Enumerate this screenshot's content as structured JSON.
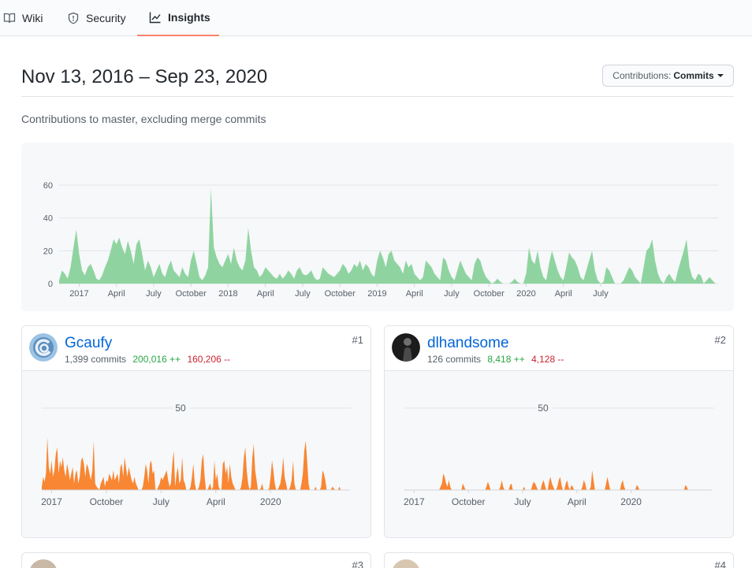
{
  "tabs": [
    {
      "label": "Wiki",
      "icon": "book-icon"
    },
    {
      "label": "Security",
      "icon": "shield-icon"
    },
    {
      "label": "Insights",
      "icon": "graph-icon",
      "active": true
    }
  ],
  "header": {
    "range": "Nov 13, 2016 – Sep 23, 2020",
    "contrib_prefix": "Contributions:",
    "contrib_value": "Commits",
    "subtitle": "Contributions to master, excluding merge commits"
  },
  "colors": {
    "main_area": "#8fd4a0",
    "user_area": "#f98632",
    "accent_tab": "#f9826c",
    "link": "#0366d6",
    "additions": "#28a745",
    "deletions": "#cb2431"
  },
  "chart_data": [
    {
      "type": "area",
      "ylim": [
        0,
        60
      ],
      "yticks": [
        0,
        20,
        40,
        60
      ],
      "x_tick_labels": [
        "2017",
        "April",
        "July",
        "October",
        "2018",
        "April",
        "July",
        "October",
        "2019",
        "April",
        "July",
        "October",
        "2020",
        "April",
        "July"
      ],
      "x_tick_weeks": [
        7,
        20,
        33,
        46,
        59,
        72,
        85,
        98,
        111,
        124,
        137,
        150,
        163,
        176,
        189
      ],
      "values": [
        2,
        8,
        6,
        3,
        10,
        22,
        33,
        18,
        8,
        5,
        10,
        12,
        8,
        3,
        2,
        5,
        10,
        14,
        20,
        27,
        24,
        28,
        22,
        18,
        26,
        20,
        12,
        24,
        27,
        18,
        8,
        14,
        10,
        4,
        8,
        12,
        6,
        4,
        10,
        14,
        8,
        6,
        4,
        10,
        6,
        4,
        14,
        20,
        12,
        4,
        2,
        5,
        10,
        58,
        22,
        16,
        12,
        10,
        14,
        18,
        12,
        22,
        14,
        10,
        8,
        14,
        34,
        20,
        10,
        8,
        4,
        6,
        10,
        8,
        6,
        4,
        3,
        6,
        3,
        5,
        8,
        6,
        3,
        8,
        10,
        6,
        5,
        6,
        8,
        4,
        2,
        3,
        10,
        8,
        6,
        5,
        4,
        6,
        8,
        12,
        10,
        6,
        8,
        12,
        10,
        14,
        8,
        12,
        10,
        6,
        4,
        14,
        20,
        16,
        10,
        18,
        20,
        14,
        12,
        10,
        6,
        14,
        10,
        12,
        6,
        4,
        2,
        4,
        14,
        12,
        10,
        6,
        4,
        2,
        16,
        14,
        8,
        4,
        2,
        8,
        14,
        10,
        6,
        4,
        2,
        12,
        16,
        14,
        8,
        4,
        2,
        0,
        1,
        3,
        1,
        0,
        0,
        0,
        1,
        3,
        1,
        0,
        0,
        6,
        22,
        14,
        12,
        20,
        10,
        4,
        2,
        12,
        20,
        14,
        8,
        4,
        2,
        10,
        19,
        16,
        14,
        10,
        4,
        2,
        8,
        14,
        20,
        8,
        2,
        0,
        1,
        10,
        8,
        4,
        0,
        0,
        0,
        2,
        6,
        10,
        8,
        4,
        2,
        0,
        10,
        20,
        22,
        27,
        14,
        6,
        2,
        0,
        4,
        6,
        3,
        1,
        8,
        14,
        20,
        27,
        10,
        4,
        2,
        6,
        5,
        0,
        2,
        4,
        2,
        0,
        0
      ]
    },
    {
      "type": "area",
      "user": "Gcaufy",
      "grid_label": "50",
      "grid_value": 50,
      "x_tick_labels": [
        "2017",
        "October",
        "July",
        "April",
        "2020"
      ],
      "x_tick_weeks": [
        7,
        46,
        85,
        124,
        163
      ],
      "values": [
        2,
        8,
        5,
        10,
        32,
        14,
        10,
        18,
        8,
        12,
        22,
        26,
        10,
        18,
        14,
        20,
        12,
        8,
        16,
        12,
        6,
        10,
        14,
        4,
        10,
        12,
        4,
        8,
        18,
        20,
        16,
        8,
        16,
        14,
        10,
        6,
        12,
        30,
        4,
        2,
        1,
        0,
        4,
        6,
        8,
        2,
        6,
        5,
        10,
        8,
        6,
        12,
        6,
        8,
        10,
        4,
        14,
        16,
        8,
        20,
        14,
        8,
        14,
        10,
        6,
        4,
        8,
        4,
        2,
        0,
        0,
        0,
        2,
        8,
        16,
        12,
        4,
        16,
        18,
        10,
        12,
        0,
        0,
        2,
        4,
        8,
        6,
        8,
        10,
        12,
        6,
        2,
        4,
        16,
        24,
        2,
        10,
        14,
        4,
        6,
        20,
        6,
        4,
        0,
        0,
        0,
        2,
        8,
        16,
        4,
        0,
        0,
        2,
        6,
        18,
        22,
        8,
        0,
        0,
        2,
        4,
        0,
        2,
        18,
        6,
        10,
        2,
        0,
        0,
        16,
        18,
        10,
        14,
        4,
        16,
        8,
        4,
        2,
        0,
        0,
        0,
        0,
        2,
        8,
        20,
        26,
        12,
        4,
        0,
        2,
        20,
        28,
        12,
        6,
        0,
        0,
        1,
        4,
        0,
        0,
        0,
        0,
        1,
        8,
        18,
        12,
        4,
        0,
        0,
        2,
        4,
        10,
        20,
        8,
        4,
        0,
        0,
        2,
        6,
        18,
        4,
        0,
        0,
        0,
        0,
        4,
        10,
        24,
        30,
        18,
        4,
        0,
        0,
        0,
        0,
        2,
        0,
        0,
        0,
        2,
        12,
        10,
        6,
        0,
        0,
        0,
        0,
        2,
        1,
        0,
        0,
        0,
        2,
        0,
        0,
        0,
        0,
        0,
        0,
        0
      ]
    },
    {
      "type": "area",
      "user": "dlhandsome",
      "grid_label": "50",
      "grid_value": 50,
      "x_tick_labels": [
        "2017",
        "October",
        "July",
        "April",
        "2020"
      ],
      "x_tick_weeks": [
        7,
        46,
        85,
        124,
        163
      ],
      "values": [
        0,
        0,
        0,
        0,
        0,
        0,
        0,
        0,
        0,
        0,
        0,
        0,
        0,
        0,
        0,
        0,
        0,
        0,
        0,
        0,
        0,
        0,
        0,
        0,
        0,
        0,
        2,
        4,
        10,
        8,
        4,
        2,
        6,
        2,
        0,
        0,
        0,
        0,
        0,
        0,
        0,
        0,
        4,
        2,
        0,
        0,
        0,
        0,
        0,
        0,
        0,
        0,
        0,
        0,
        0,
        0,
        0,
        0,
        0,
        2,
        5,
        3,
        0,
        0,
        0,
        0,
        0,
        0,
        0,
        2,
        6,
        2,
        0,
        0,
        0,
        0,
        3,
        4,
        0,
        0,
        0,
        0,
        0,
        0,
        0,
        0,
        2,
        0,
        0,
        0,
        0,
        0,
        3,
        5,
        4,
        2,
        0,
        0,
        0,
        4,
        6,
        3,
        0,
        0,
        5,
        8,
        4,
        2,
        0,
        0,
        2,
        6,
        8,
        3,
        0,
        0,
        4,
        6,
        2,
        0,
        3,
        2,
        0,
        0,
        0,
        0,
        0,
        0,
        2,
        6,
        4,
        0,
        0,
        0,
        2,
        12,
        6,
        0,
        0,
        0,
        0,
        0,
        0,
        0,
        0,
        4,
        8,
        4,
        0,
        0,
        0,
        0,
        0,
        0,
        0,
        0,
        4,
        6,
        2,
        0,
        0,
        0,
        0,
        0,
        0,
        0,
        0,
        3,
        2,
        0,
        0,
        0,
        0,
        0,
        0,
        0,
        0,
        0,
        0,
        0,
        0,
        0,
        0,
        0,
        0,
        0,
        0,
        0,
        0,
        0,
        0,
        0,
        0,
        0,
        0,
        0,
        0,
        0,
        0,
        0,
        0,
        0,
        3,
        2,
        0,
        0,
        0,
        0,
        0,
        0,
        0,
        0,
        0,
        0,
        0,
        0,
        0,
        0,
        0,
        0,
        0,
        0
      ]
    }
  ],
  "contributors": [
    {
      "name": "Gcaufy",
      "commits": "1,399 commits",
      "additions": "200,016 ++",
      "deletions": "160,206 --",
      "rank": "#1"
    },
    {
      "name": "dlhandsome",
      "commits": "126 commits",
      "additions": "8,418 ++",
      "deletions": "4,128 --",
      "rank": "#2"
    }
  ],
  "peek_cards": [
    {
      "rank": "#3"
    },
    {
      "rank": "#4"
    }
  ]
}
